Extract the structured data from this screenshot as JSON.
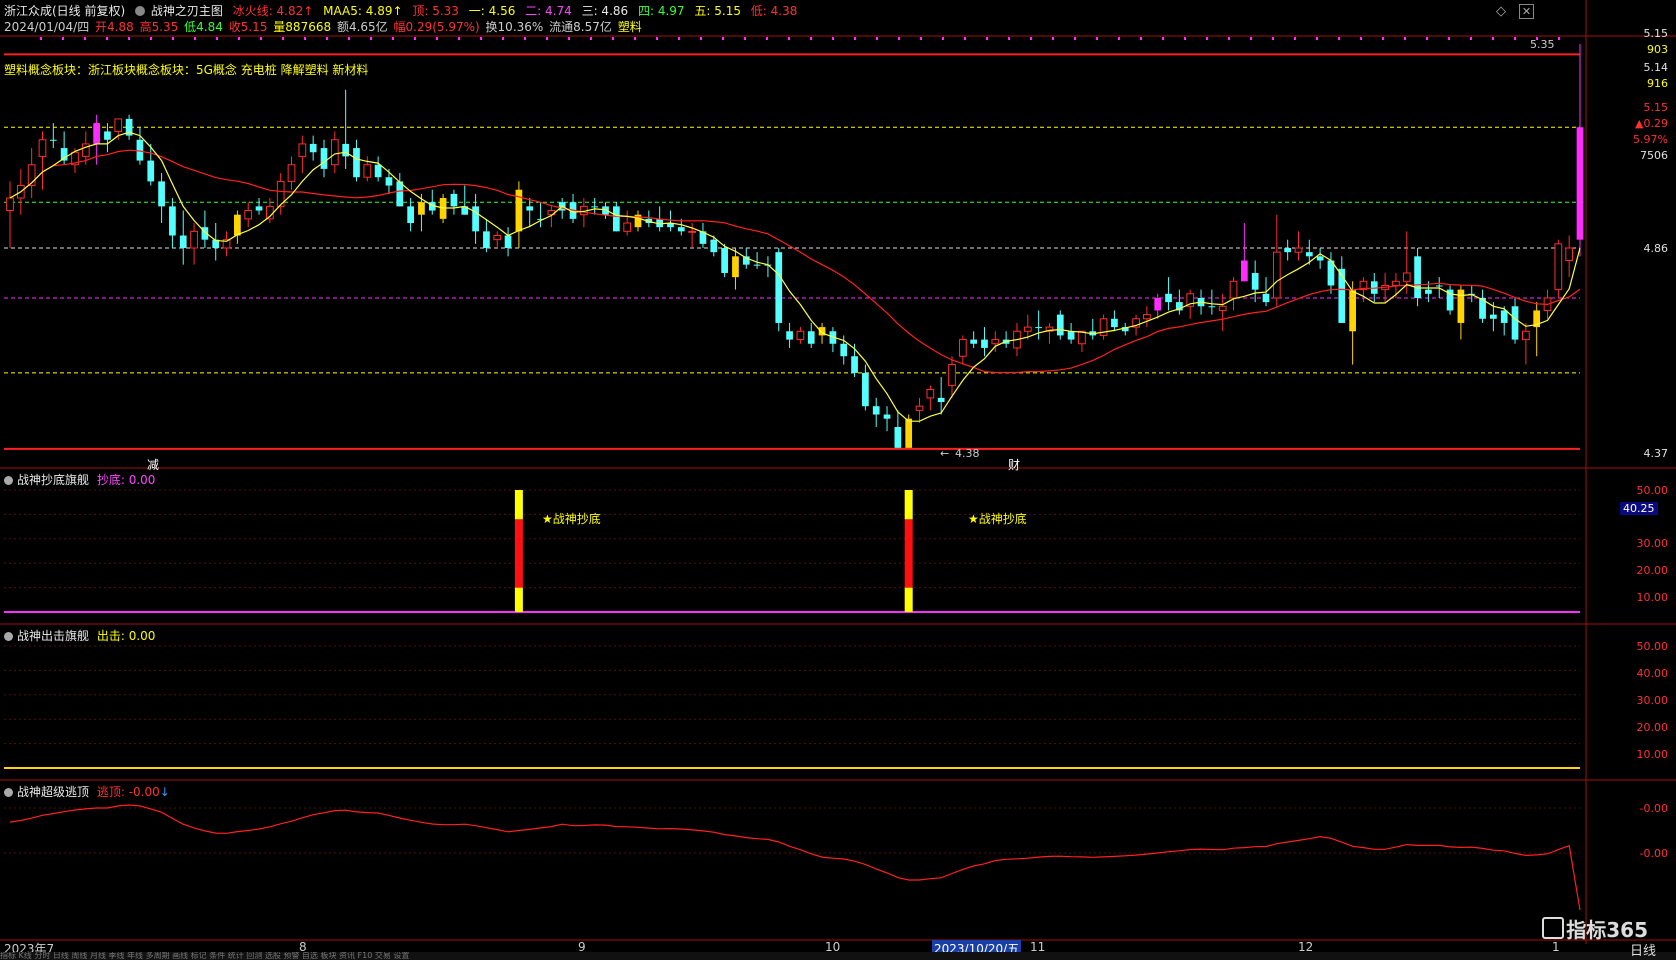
{
  "header": {
    "stock": "浙江众成(日线 前复权)",
    "indicator": "战神之刃主图",
    "bingfire": "冰火线: 4.82↑",
    "maa5": "MAA5: 4.89↑",
    "top": "顶: 5.33",
    "l1": "一: 4.56",
    "l2": "二: 4.74",
    "l3": "三: 4.86",
    "l4": "四: 4.97",
    "l5": "五: 5.15",
    "low": "低: 4.38",
    "date": "2024/01/04/四",
    "open": "开4.88",
    "high": "高5.35",
    "lowp": "低4.84",
    "close": "收5.15",
    "vol": "量887668",
    "amount": "额4.65亿",
    "change": "幅0.29(5.97%)",
    "turnover": "换10.36%",
    "float": "流通8.57亿",
    "sector": "塑料"
  },
  "concept_line": "塑料概念板块：浙江板块概念板块：5G概念 充电桩 降解塑料 新材料",
  "right_axis": {
    "p1": "5.15",
    "p1b": "903",
    "p2": "5.14",
    "p2b": "916",
    "p3": "5.15",
    "p4": "▲0.29",
    "p5": "5.97%",
    "p6": "7506",
    "p7": "4.86",
    "p8": "4.37"
  },
  "annotations": {
    "high_label": "5.35",
    "low_label": "4.38",
    "mark_jian": "减",
    "mark_cai": "财"
  },
  "panel1": {
    "title": "战神抄底旗舰",
    "value_label": "抄底: 0.00",
    "signal_text": "★战神抄底",
    "ticks": [
      "50.00",
      "40.00",
      "30.00",
      "20.00",
      "10.00"
    ],
    "current": "40.25"
  },
  "panel2": {
    "title": "战神出击旗舰",
    "value_label": "出击: 0.00",
    "ticks": [
      "50.00",
      "40.00",
      "30.00",
      "20.00",
      "10.00"
    ]
  },
  "panel3": {
    "title": "战神超级逃顶",
    "value_label": "逃顶: -0.00",
    "ticks": [
      "-0.00",
      "-0.00"
    ]
  },
  "xaxis": {
    "labels": [
      "2023年7",
      "8",
      "9",
      "10",
      "2023/10/20/五",
      "11",
      "12",
      "1"
    ]
  },
  "bottom_bar": "指标  K线  分时  日线  周线  月线  季线  年线  多周期  画线  标记  条件  统计  回测  选股  预警  自选  板块  资讯  F10  交易  设置",
  "logo": "指标365",
  "period": "日线",
  "colors": {
    "up": "#ff2d2d",
    "down": "#54ffff",
    "yellow": "#ffd400",
    "magenta": "#ff2dff",
    "red": "#e02020"
  },
  "chart_data": {
    "type": "candlestick",
    "title": "浙江众成(日线 前复权)",
    "ylim": [
      4.37,
      5.35
    ],
    "yticks": [
      4.37,
      4.86,
      5.15
    ],
    "levels": {
      "top": 5.33,
      "one": 4.56,
      "two": 4.74,
      "three": 4.86,
      "four": 4.97,
      "five": 5.15,
      "low": 4.38
    },
    "candles": [
      {
        "o": 4.95,
        "h": 5.02,
        "l": 4.86,
        "c": 4.98,
        "t": "u"
      },
      {
        "o": 4.98,
        "h": 5.05,
        "l": 4.94,
        "c": 5.01,
        "t": "u"
      },
      {
        "o": 5.01,
        "h": 5.1,
        "l": 4.98,
        "c": 5.06,
        "t": "u"
      },
      {
        "o": 5.08,
        "h": 5.14,
        "l": 5.0,
        "c": 5.12,
        "t": "u"
      },
      {
        "o": 5.12,
        "h": 5.16,
        "l": 5.1,
        "c": 5.12,
        "t": "d"
      },
      {
        "o": 5.1,
        "h": 5.14,
        "l": 5.06,
        "c": 5.07,
        "t": "d"
      },
      {
        "o": 5.06,
        "h": 5.1,
        "l": 5.04,
        "c": 5.09,
        "t": "u"
      },
      {
        "o": 5.08,
        "h": 5.14,
        "l": 5.06,
        "c": 5.11,
        "t": "u"
      },
      {
        "o": 5.11,
        "h": 5.18,
        "l": 5.06,
        "c": 5.16,
        "t": "m"
      },
      {
        "o": 5.14,
        "h": 5.16,
        "l": 5.09,
        "c": 5.12,
        "t": "d"
      },
      {
        "o": 5.14,
        "h": 5.17,
        "l": 5.12,
        "c": 5.17,
        "t": "u"
      },
      {
        "o": 5.17,
        "h": 5.18,
        "l": 5.12,
        "c": 5.13,
        "t": "d"
      },
      {
        "o": 5.12,
        "h": 5.15,
        "l": 5.06,
        "c": 5.07,
        "t": "d"
      },
      {
        "o": 5.07,
        "h": 5.11,
        "l": 5.01,
        "c": 5.02,
        "t": "d"
      },
      {
        "o": 5.02,
        "h": 5.04,
        "l": 4.92,
        "c": 4.96,
        "t": "d"
      },
      {
        "o": 4.96,
        "h": 4.98,
        "l": 4.86,
        "c": 4.89,
        "t": "d"
      },
      {
        "o": 4.89,
        "h": 4.95,
        "l": 4.82,
        "c": 4.86,
        "t": "d"
      },
      {
        "o": 4.86,
        "h": 4.92,
        "l": 4.82,
        "c": 4.9,
        "t": "u"
      },
      {
        "o": 4.91,
        "h": 4.95,
        "l": 4.86,
        "c": 4.88,
        "t": "d"
      },
      {
        "o": 4.88,
        "h": 4.92,
        "l": 4.83,
        "c": 4.86,
        "t": "d"
      },
      {
        "o": 4.86,
        "h": 4.9,
        "l": 4.84,
        "c": 4.88,
        "t": "u"
      },
      {
        "o": 4.89,
        "h": 4.95,
        "l": 4.87,
        "c": 4.94,
        "t": "y"
      },
      {
        "o": 4.93,
        "h": 4.97,
        "l": 4.91,
        "c": 4.95,
        "t": "u"
      },
      {
        "o": 4.96,
        "h": 4.98,
        "l": 4.94,
        "c": 4.95,
        "t": "d"
      },
      {
        "o": 4.93,
        "h": 4.98,
        "l": 4.92,
        "c": 4.96,
        "t": "u"
      },
      {
        "o": 4.96,
        "h": 5.04,
        "l": 4.94,
        "c": 5.02,
        "t": "u"
      },
      {
        "o": 5.02,
        "h": 5.08,
        "l": 5.0,
        "c": 5.06,
        "t": "u"
      },
      {
        "o": 5.08,
        "h": 5.13,
        "l": 5.04,
        "c": 5.11,
        "t": "u"
      },
      {
        "o": 5.11,
        "h": 5.13,
        "l": 5.07,
        "c": 5.09,
        "t": "d"
      },
      {
        "o": 5.1,
        "h": 5.12,
        "l": 5.03,
        "c": 5.05,
        "t": "d"
      },
      {
        "o": 5.06,
        "h": 5.14,
        "l": 5.04,
        "c": 5.12,
        "t": "u"
      },
      {
        "o": 5.11,
        "h": 5.24,
        "l": 5.05,
        "c": 5.08,
        "t": "d"
      },
      {
        "o": 5.1,
        "h": 5.12,
        "l": 5.02,
        "c": 5.03,
        "t": "d"
      },
      {
        "o": 5.03,
        "h": 5.08,
        "l": 5.02,
        "c": 5.06,
        "t": "u"
      },
      {
        "o": 5.06,
        "h": 5.08,
        "l": 5.02,
        "c": 5.03,
        "t": "d"
      },
      {
        "o": 5.03,
        "h": 5.05,
        "l": 4.99,
        "c": 5.01,
        "t": "d"
      },
      {
        "o": 5.02,
        "h": 5.04,
        "l": 4.96,
        "c": 4.96,
        "t": "d"
      },
      {
        "o": 4.96,
        "h": 4.98,
        "l": 4.9,
        "c": 4.92,
        "t": "d"
      },
      {
        "o": 4.94,
        "h": 4.99,
        "l": 4.9,
        "c": 4.97,
        "t": "y"
      },
      {
        "o": 4.97,
        "h": 5.0,
        "l": 4.94,
        "c": 4.95,
        "t": "d"
      },
      {
        "o": 4.93,
        "h": 4.99,
        "l": 4.92,
        "c": 4.98,
        "t": "y"
      },
      {
        "o": 4.99,
        "h": 5.0,
        "l": 4.94,
        "c": 4.96,
        "t": "d"
      },
      {
        "o": 4.96,
        "h": 5.01,
        "l": 4.94,
        "c": 4.94,
        "t": "d"
      },
      {
        "o": 4.96,
        "h": 4.99,
        "l": 4.87,
        "c": 4.9,
        "t": "d"
      },
      {
        "o": 4.9,
        "h": 4.93,
        "l": 4.85,
        "c": 4.86,
        "t": "d"
      },
      {
        "o": 4.88,
        "h": 4.9,
        "l": 4.86,
        "c": 4.89,
        "t": "u"
      },
      {
        "o": 4.89,
        "h": 4.91,
        "l": 4.84,
        "c": 4.86,
        "t": "d"
      },
      {
        "o": 4.9,
        "h": 5.02,
        "l": 4.86,
        "c": 5.0,
        "t": "y"
      },
      {
        "o": 4.96,
        "h": 4.98,
        "l": 4.91,
        "c": 4.95,
        "t": "d"
      },
      {
        "o": 4.93,
        "h": 4.97,
        "l": 4.91,
        "c": 4.93,
        "t": "d"
      },
      {
        "o": 4.94,
        "h": 4.96,
        "l": 4.91,
        "c": 4.95,
        "t": "u"
      },
      {
        "o": 4.95,
        "h": 4.98,
        "l": 4.93,
        "c": 4.97,
        "t": "d"
      },
      {
        "o": 4.97,
        "h": 4.99,
        "l": 4.92,
        "c": 4.93,
        "t": "d"
      },
      {
        "o": 4.94,
        "h": 4.98,
        "l": 4.91,
        "c": 4.96,
        "t": "u"
      },
      {
        "o": 4.96,
        "h": 4.98,
        "l": 4.94,
        "c": 4.96,
        "t": "d"
      },
      {
        "o": 4.96,
        "h": 4.97,
        "l": 4.93,
        "c": 4.94,
        "t": "d"
      },
      {
        "o": 4.96,
        "h": 4.97,
        "l": 4.9,
        "c": 4.9,
        "t": "d"
      },
      {
        "o": 4.9,
        "h": 4.95,
        "l": 4.89,
        "c": 4.92,
        "t": "u"
      },
      {
        "o": 4.91,
        "h": 4.95,
        "l": 4.9,
        "c": 4.94,
        "t": "y"
      },
      {
        "o": 4.93,
        "h": 4.95,
        "l": 4.91,
        "c": 4.92,
        "t": "d"
      },
      {
        "o": 4.93,
        "h": 4.96,
        "l": 4.9,
        "c": 4.91,
        "t": "d"
      },
      {
        "o": 4.92,
        "h": 4.95,
        "l": 4.9,
        "c": 4.91,
        "t": "d"
      },
      {
        "o": 4.91,
        "h": 4.93,
        "l": 4.89,
        "c": 4.9,
        "t": "d"
      },
      {
        "o": 4.9,
        "h": 4.92,
        "l": 4.86,
        "c": 4.9,
        "t": "u"
      },
      {
        "o": 4.9,
        "h": 4.92,
        "l": 4.86,
        "c": 4.87,
        "t": "d"
      },
      {
        "o": 4.88,
        "h": 4.89,
        "l": 4.84,
        "c": 4.85,
        "t": "d"
      },
      {
        "o": 4.86,
        "h": 4.87,
        "l": 4.79,
        "c": 4.8,
        "t": "d"
      },
      {
        "o": 4.79,
        "h": 4.86,
        "l": 4.76,
        "c": 4.84,
        "t": "y"
      },
      {
        "o": 4.84,
        "h": 4.86,
        "l": 4.81,
        "c": 4.82,
        "t": "d"
      },
      {
        "o": 4.82,
        "h": 4.85,
        "l": 4.81,
        "c": 4.82,
        "t": "d"
      },
      {
        "o": 4.82,
        "h": 4.84,
        "l": 4.79,
        "c": 4.82,
        "t": "d"
      },
      {
        "o": 4.85,
        "h": 4.86,
        "l": 4.66,
        "c": 4.68,
        "t": "d"
      },
      {
        "o": 4.66,
        "h": 4.68,
        "l": 4.62,
        "c": 4.64,
        "t": "d"
      },
      {
        "o": 4.64,
        "h": 4.67,
        "l": 4.63,
        "c": 4.66,
        "t": "u"
      },
      {
        "o": 4.66,
        "h": 4.68,
        "l": 4.62,
        "c": 4.63,
        "t": "d"
      },
      {
        "o": 4.65,
        "h": 4.68,
        "l": 4.63,
        "c": 4.67,
        "t": "y"
      },
      {
        "o": 4.66,
        "h": 4.67,
        "l": 4.61,
        "c": 4.63,
        "t": "d"
      },
      {
        "o": 4.63,
        "h": 4.65,
        "l": 4.58,
        "c": 4.6,
        "t": "d"
      },
      {
        "o": 4.6,
        "h": 4.63,
        "l": 4.55,
        "c": 4.56,
        "t": "d"
      },
      {
        "o": 4.56,
        "h": 4.58,
        "l": 4.47,
        "c": 4.48,
        "t": "d"
      },
      {
        "o": 4.48,
        "h": 4.5,
        "l": 4.43,
        "c": 4.46,
        "t": "d"
      },
      {
        "o": 4.46,
        "h": 4.48,
        "l": 4.42,
        "c": 4.45,
        "t": "d"
      },
      {
        "o": 4.43,
        "h": 4.47,
        "l": 4.38,
        "c": 4.38,
        "t": "d"
      },
      {
        "o": 4.38,
        "h": 4.46,
        "l": 4.38,
        "c": 4.45,
        "t": "y"
      },
      {
        "o": 4.47,
        "h": 4.5,
        "l": 4.44,
        "c": 4.48,
        "t": "u"
      },
      {
        "o": 4.5,
        "h": 4.53,
        "l": 4.47,
        "c": 4.52,
        "t": "u"
      },
      {
        "o": 4.5,
        "h": 4.55,
        "l": 4.46,
        "c": 4.49,
        "t": "d"
      },
      {
        "o": 4.53,
        "h": 4.6,
        "l": 4.5,
        "c": 4.58,
        "t": "u"
      },
      {
        "o": 4.6,
        "h": 4.65,
        "l": 4.58,
        "c": 4.64,
        "t": "u"
      },
      {
        "o": 4.63,
        "h": 4.66,
        "l": 4.62,
        "c": 4.64,
        "t": "d"
      },
      {
        "o": 4.64,
        "h": 4.67,
        "l": 4.6,
        "c": 4.62,
        "t": "d"
      },
      {
        "o": 4.63,
        "h": 4.66,
        "l": 4.61,
        "c": 4.64,
        "t": "u"
      },
      {
        "o": 4.63,
        "h": 4.66,
        "l": 4.62,
        "c": 4.64,
        "t": "d"
      },
      {
        "o": 4.62,
        "h": 4.68,
        "l": 4.6,
        "c": 4.66,
        "t": "u"
      },
      {
        "o": 4.66,
        "h": 4.7,
        "l": 4.64,
        "c": 4.67,
        "t": "u"
      },
      {
        "o": 4.67,
        "h": 4.71,
        "l": 4.64,
        "c": 4.67,
        "t": "d"
      },
      {
        "o": 4.66,
        "h": 4.68,
        "l": 4.63,
        "c": 4.67,
        "t": "u"
      },
      {
        "o": 4.7,
        "h": 4.71,
        "l": 4.64,
        "c": 4.65,
        "t": "d"
      },
      {
        "o": 4.66,
        "h": 4.68,
        "l": 4.63,
        "c": 4.64,
        "t": "d"
      },
      {
        "o": 4.63,
        "h": 4.66,
        "l": 4.61,
        "c": 4.66,
        "t": "u"
      },
      {
        "o": 4.66,
        "h": 4.69,
        "l": 4.64,
        "c": 4.65,
        "t": "d"
      },
      {
        "o": 4.65,
        "h": 4.7,
        "l": 4.64,
        "c": 4.69,
        "t": "u"
      },
      {
        "o": 4.69,
        "h": 4.71,
        "l": 4.66,
        "c": 4.67,
        "t": "d"
      },
      {
        "o": 4.66,
        "h": 4.68,
        "l": 4.65,
        "c": 4.67,
        "t": "d"
      },
      {
        "o": 4.67,
        "h": 4.7,
        "l": 4.65,
        "c": 4.69,
        "t": "u"
      },
      {
        "o": 4.69,
        "h": 4.72,
        "l": 4.67,
        "c": 4.7,
        "t": "u"
      },
      {
        "o": 4.71,
        "h": 4.75,
        "l": 4.69,
        "c": 4.74,
        "t": "m"
      },
      {
        "o": 4.75,
        "h": 4.79,
        "l": 4.71,
        "c": 4.73,
        "t": "d"
      },
      {
        "o": 4.73,
        "h": 4.76,
        "l": 4.7,
        "c": 4.71,
        "t": "d"
      },
      {
        "o": 4.72,
        "h": 4.76,
        "l": 4.69,
        "c": 4.75,
        "t": "u"
      },
      {
        "o": 4.74,
        "h": 4.76,
        "l": 4.7,
        "c": 4.72,
        "t": "d"
      },
      {
        "o": 4.72,
        "h": 4.76,
        "l": 4.7,
        "c": 4.72,
        "t": "d"
      },
      {
        "o": 4.71,
        "h": 4.75,
        "l": 4.66,
        "c": 4.72,
        "t": "u"
      },
      {
        "o": 4.74,
        "h": 4.79,
        "l": 4.71,
        "c": 4.78,
        "t": "u"
      },
      {
        "o": 4.83,
        "h": 4.92,
        "l": 4.78,
        "c": 4.78,
        "t": "m"
      },
      {
        "o": 4.8,
        "h": 4.83,
        "l": 4.73,
        "c": 4.76,
        "t": "d"
      },
      {
        "o": 4.75,
        "h": 4.79,
        "l": 4.72,
        "c": 4.73,
        "t": "d"
      },
      {
        "o": 4.74,
        "h": 4.94,
        "l": 4.72,
        "c": 4.85,
        "t": "u"
      },
      {
        "o": 4.85,
        "h": 4.88,
        "l": 4.83,
        "c": 4.86,
        "t": "d"
      },
      {
        "o": 4.86,
        "h": 4.9,
        "l": 4.83,
        "c": 4.85,
        "t": "u"
      },
      {
        "o": 4.85,
        "h": 4.88,
        "l": 4.82,
        "c": 4.84,
        "t": "d"
      },
      {
        "o": 4.84,
        "h": 4.86,
        "l": 4.81,
        "c": 4.83,
        "t": "d"
      },
      {
        "o": 4.83,
        "h": 4.85,
        "l": 4.75,
        "c": 4.77,
        "t": "d"
      },
      {
        "o": 4.81,
        "h": 4.84,
        "l": 4.71,
        "c": 4.68,
        "t": "d"
      },
      {
        "o": 4.76,
        "h": 4.78,
        "l": 4.58,
        "c": 4.66,
        "t": "y"
      },
      {
        "o": 4.76,
        "h": 4.79,
        "l": 4.73,
        "c": 4.78,
        "t": "u"
      },
      {
        "o": 4.78,
        "h": 4.8,
        "l": 4.73,
        "c": 4.75,
        "t": "d"
      },
      {
        "o": 4.76,
        "h": 4.8,
        "l": 4.73,
        "c": 4.77,
        "t": "u"
      },
      {
        "o": 4.77,
        "h": 4.8,
        "l": 4.74,
        "c": 4.78,
        "t": "u"
      },
      {
        "o": 4.8,
        "h": 4.9,
        "l": 4.75,
        "c": 4.78,
        "t": "u"
      },
      {
        "o": 4.84,
        "h": 4.86,
        "l": 4.72,
        "c": 4.74,
        "t": "d"
      },
      {
        "o": 4.76,
        "h": 4.78,
        "l": 4.73,
        "c": 4.75,
        "t": "d"
      },
      {
        "o": 4.77,
        "h": 4.79,
        "l": 4.74,
        "c": 4.77,
        "t": "d"
      },
      {
        "o": 4.76,
        "h": 4.77,
        "l": 4.7,
        "c": 4.71,
        "t": "d"
      },
      {
        "o": 4.68,
        "h": 4.77,
        "l": 4.64,
        "c": 4.76,
        "t": "y"
      },
      {
        "o": 4.75,
        "h": 4.77,
        "l": 4.73,
        "c": 4.75,
        "t": "d"
      },
      {
        "o": 4.74,
        "h": 4.76,
        "l": 4.68,
        "c": 4.69,
        "t": "d"
      },
      {
        "o": 4.7,
        "h": 4.73,
        "l": 4.66,
        "c": 4.69,
        "t": "d"
      },
      {
        "o": 4.71,
        "h": 4.72,
        "l": 4.65,
        "c": 4.68,
        "t": "d"
      },
      {
        "o": 4.72,
        "h": 4.74,
        "l": 4.63,
        "c": 4.64,
        "t": "d"
      },
      {
        "o": 4.64,
        "h": 4.68,
        "l": 4.58,
        "c": 4.66,
        "t": "u"
      },
      {
        "o": 4.67,
        "h": 4.73,
        "l": 4.6,
        "c": 4.71,
        "t": "y"
      },
      {
        "o": 4.71,
        "h": 4.76,
        "l": 4.69,
        "c": 4.74,
        "t": "u"
      },
      {
        "o": 4.76,
        "h": 4.88,
        "l": 4.74,
        "c": 4.87,
        "t": "u"
      },
      {
        "o": 4.86,
        "h": 4.89,
        "l": 4.79,
        "c": 4.83,
        "t": "u"
      },
      {
        "o": 4.88,
        "h": 5.35,
        "l": 4.84,
        "c": 5.15,
        "t": "m"
      }
    ],
    "series": [
      {
        "name": "冰火线",
        "values": []
      },
      {
        "name": "MAA5",
        "values": []
      }
    ],
    "lower_panels": [
      {
        "name": "战神抄底旗舰",
        "signals": [
          {
            "index": 47,
            "label": "★战神抄底"
          },
          {
            "index": 83,
            "label": "★战神抄底"
          }
        ]
      },
      {
        "name": "战神出击旗舰",
        "signals": []
      },
      {
        "name": "战神超级逃顶",
        "values": []
      }
    ]
  }
}
